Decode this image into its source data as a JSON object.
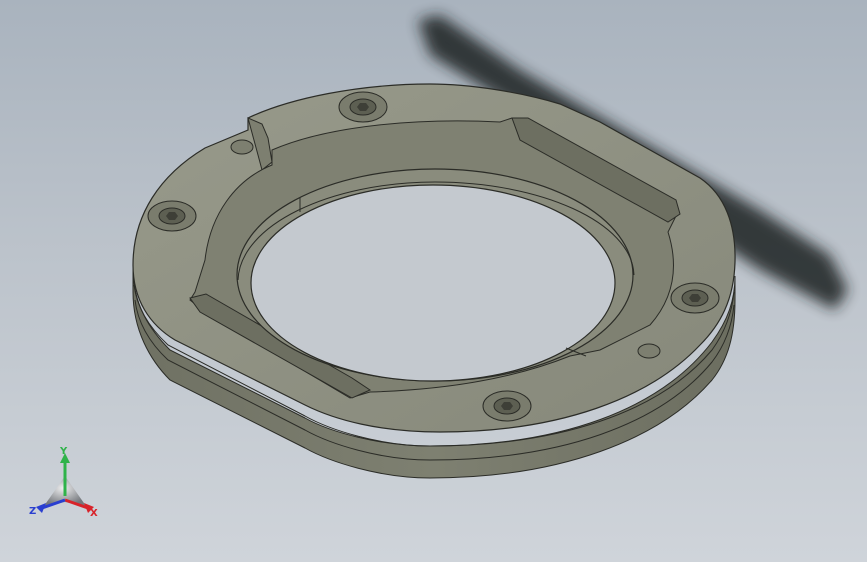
{
  "viewport": {
    "background_top": "#a9b3be",
    "background_bottom": "#cfd4da"
  },
  "part": {
    "description_color": "#8a8c7e",
    "top_color": "#8d8f80",
    "side_color": "#7a7c6d",
    "dark_edge_color": "#2b2c27",
    "bolt_holes": 4,
    "pin_holes": 2
  },
  "triad": {
    "x_label": "X",
    "y_label": "Y",
    "z_label": "Z",
    "x_color": "#d8232a",
    "y_color": "#2fb34a",
    "z_color": "#2a3fd0"
  }
}
